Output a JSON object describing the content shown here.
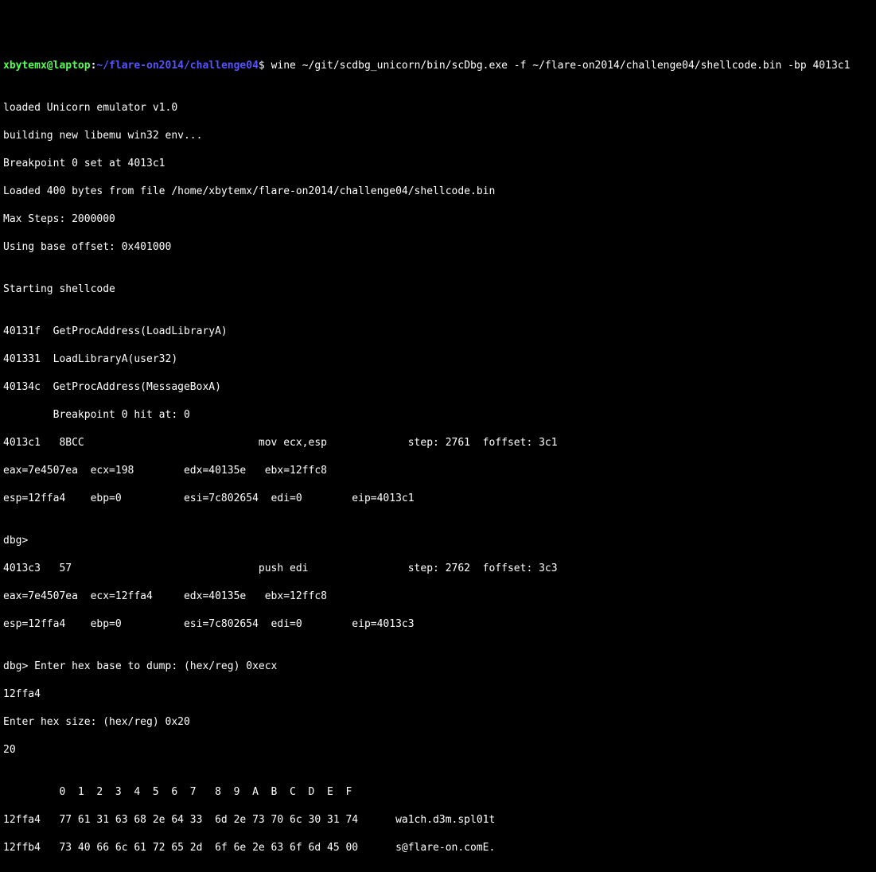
{
  "prompt": {
    "user": "xbytemx@laptop",
    "colon": ":",
    "path": "~/flare-on2014/challenge04",
    "dollar": "$ "
  },
  "command": "wine ~/git/scdbg_unicorn/bin/scDbg.exe -f ~/flare-on2014/challenge04/shellcode.bin -bp 4013c1",
  "output": {
    "l01": "",
    "l02": "loaded Unicorn emulator v1.0",
    "l03": "building new libemu win32 env...",
    "l04": "Breakpoint 0 set at 4013c1",
    "l05": "Loaded 400 bytes from file /home/xbytemx/flare-on2014/challenge04/shellcode.bin",
    "l06": "Max Steps: 2000000",
    "l07": "Using base offset: 0x401000",
    "l08": "",
    "l09": "Starting shellcode",
    "l10": "",
    "l11": "40131f  GetProcAddress(LoadLibraryA)",
    "l12": "401331  LoadLibraryA(user32)",
    "l13": "40134c  GetProcAddress(MessageBoxA)",
    "l14": "        Breakpoint 0 hit at: 0",
    "l15": "4013c1   8BCC                            mov ecx,esp             step: 2761  foffset: 3c1",
    "l16": "eax=7e4507ea  ecx=198        edx=40135e   ebx=12ffc8  ",
    "l17": "esp=12ffa4    ebp=0          esi=7c802654  edi=0        eip=4013c1  ",
    "l18": "",
    "l19": "dbg> ",
    "l20": "4013c3   57                              push edi                step: 2762  foffset: 3c3",
    "l21": "eax=7e4507ea  ecx=12ffa4     edx=40135e   ebx=12ffc8  ",
    "l22": "esp=12ffa4    ebp=0          esi=7c802654  edi=0        eip=4013c3  ",
    "l23": "",
    "l24": "dbg> Enter hex base to dump: (hex/reg) 0xecx",
    "l25": "12ffa4",
    "l26": "Enter hex size: (hex/reg) 0x20",
    "l27": "20",
    "l28": "",
    "l29": "         0  1  2  3  4  5  6  7   8  9  A  B  C  D  E  F",
    "l30": "12ffa4   77 61 31 63 68 2e 64 33  6d 2e 73 70 6c 30 31 74      wa1ch.d3m.spl01t",
    "l31": "12ffb4   73 40 66 6c 61 72 65 2d  6f 6e 2e 63 6f 6d 45 00      s@flare-on.comE."
  }
}
